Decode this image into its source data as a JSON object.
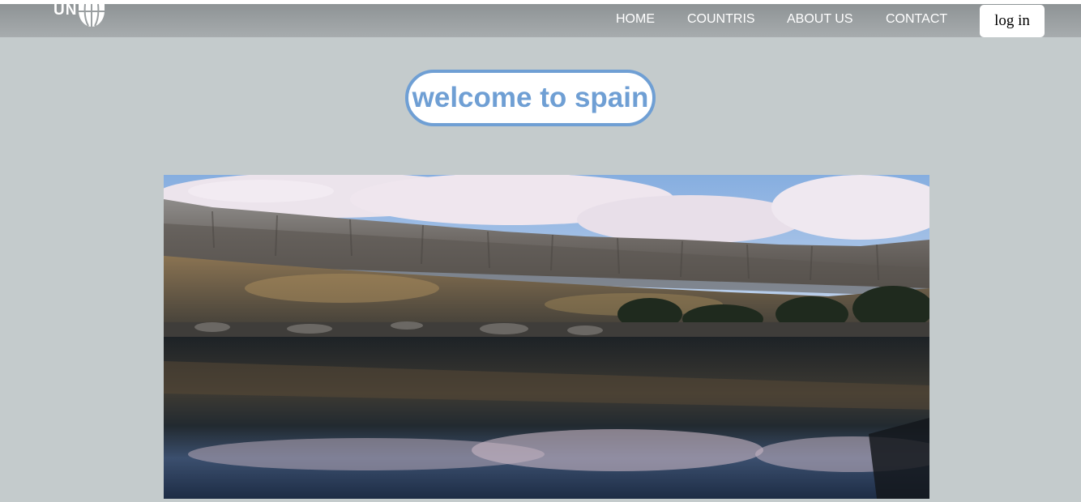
{
  "header": {
    "logo_text": "UN",
    "logo_icon": "globe-icon",
    "nav": [
      {
        "label": "HOME"
      },
      {
        "label": "COUNTRIS"
      },
      {
        "label": "ABOUT US"
      },
      {
        "label": "CONTACT"
      }
    ],
    "login_label": "log in"
  },
  "main": {
    "welcome_title": "welcome to spain",
    "hero_image": "lake-cliffs-reflection-photo"
  },
  "colors": {
    "page_bg": "#c4cbcc",
    "navbar": "#9a9fa1",
    "accent": "#6f9fd4"
  }
}
